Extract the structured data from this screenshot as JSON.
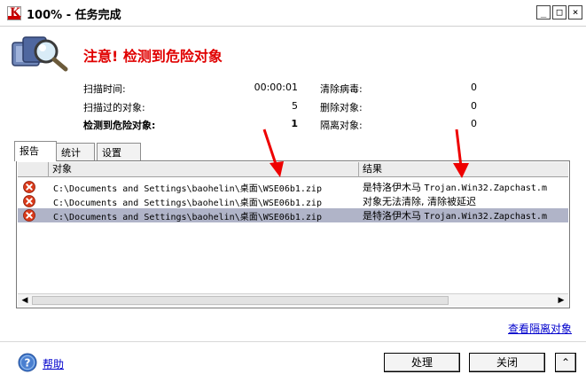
{
  "window": {
    "title": "100% - 任务完成",
    "minimize": "_",
    "maximize": "□",
    "close": "×"
  },
  "header": {
    "title": "注意! 检测到危险对象"
  },
  "stats": {
    "scan_time_label": "扫描时间:",
    "scan_time_value": "00:00:01",
    "scanned_label": "扫描过的对象:",
    "scanned_value": "5",
    "detected_label": "检测到危险对象:",
    "detected_value": "1",
    "disinfected_label": "清除病毒:",
    "disinfected_value": "0",
    "deleted_label": "删除对象:",
    "deleted_value": "0",
    "quarantined_label": "隔离对象:",
    "quarantined_value": "0"
  },
  "tabs": [
    "报告",
    "统计",
    "设置"
  ],
  "table": {
    "columns": [
      "对象",
      "结果"
    ],
    "rows": [
      {
        "object": "C:\\Documents and Settings\\baohelin\\桌面\\WSE06b1.zip",
        "result_text": "是特洛伊木马 ",
        "result_mono": "Trojan.Win32.Zapchast.m"
      },
      {
        "object": "C:\\Documents and Settings\\baohelin\\桌面\\WSE06b1.zip",
        "result_text": "对象无法清除, 清除被延迟",
        "result_mono": ""
      },
      {
        "object": "C:\\Documents and Settings\\baohelin\\桌面\\WSE06b1.zip",
        "result_text": "是特洛伊木马 ",
        "result_mono": "Trojan.Win32.Zapchast.m"
      }
    ]
  },
  "links": {
    "view_quarantine": "查看隔离对象",
    "help": "帮助"
  },
  "buttons": {
    "process": "处理",
    "close": "关闭",
    "collapse": "⌃"
  },
  "colors": {
    "alert_title": "#e00000",
    "selected_row": "#b0b4c8",
    "annotation_arrow": "#ee0000",
    "error_icon": "#d93a1a"
  }
}
